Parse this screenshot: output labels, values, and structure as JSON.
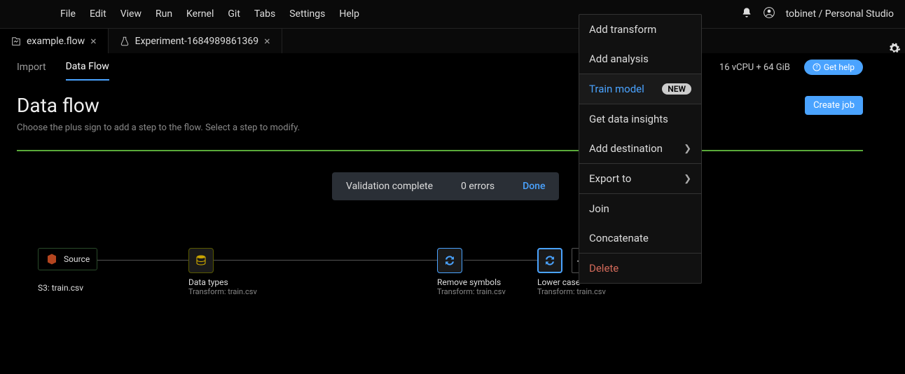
{
  "menu": [
    "File",
    "Edit",
    "View",
    "Run",
    "Kernel",
    "Git",
    "Tabs",
    "Settings",
    "Help"
  ],
  "user_label": "tobinet / Personal Studio",
  "tabs": [
    {
      "label": "example.flow",
      "active": true
    },
    {
      "label": "Experiment-1684989861369",
      "active": false
    }
  ],
  "subtabs": {
    "import": "Import",
    "dataflow": "Data Flow"
  },
  "resources": "16 vCPU + 64 GiB",
  "get_help": "Get help",
  "page_title": "Data flow",
  "page_subtitle": "Choose the plus sign to add a step to the flow. Select a step to modify.",
  "create_job": "Create job",
  "validation": {
    "status": "Validation complete",
    "errors": "0 errors",
    "action": "Done"
  },
  "nodes": {
    "source": {
      "pill": "Source",
      "title": "S3: train.csv"
    },
    "datatypes": {
      "title": "Data types",
      "sub": "Transform: train.csv"
    },
    "remove": {
      "title": "Remove symbols",
      "sub": "Transform: train.csv"
    },
    "lower": {
      "title": "Lower case",
      "sub": "Transform: train.csv"
    }
  },
  "plus_label": "+",
  "context_menu": {
    "add_transform": "Add transform",
    "add_analysis": "Add analysis",
    "train_model": "Train model",
    "train_model_badge": "NEW",
    "get_insights": "Get data insights",
    "add_destination": "Add destination",
    "export_to": "Export to",
    "join": "Join",
    "concatenate": "Concatenate",
    "delete": "Delete"
  }
}
